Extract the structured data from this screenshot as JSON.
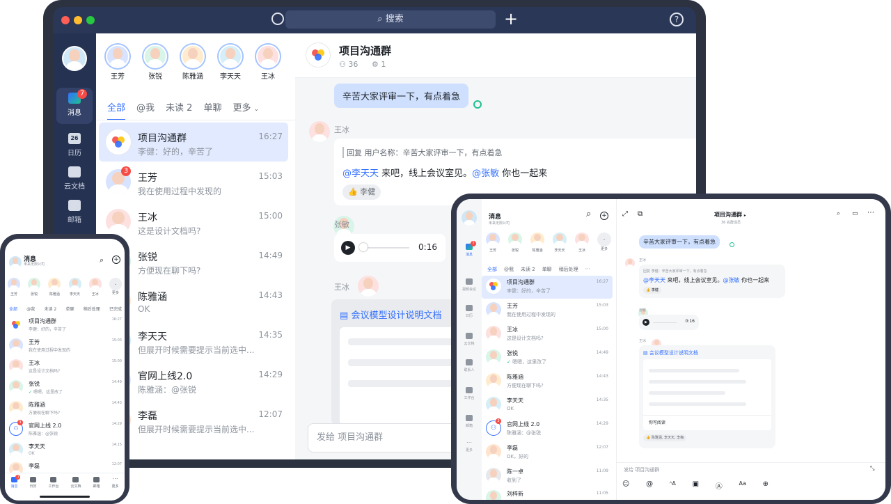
{
  "colors": {
    "accent": "#3370ff",
    "bubble_self": "#cfe0ff",
    "badge": "#f54a45",
    "teal": "#1fbf8f"
  },
  "laptop": {
    "search_placeholder": "搜索",
    "nav": [
      {
        "label": "消息",
        "badge": "7"
      },
      {
        "label": "日历",
        "icon_text": "26"
      },
      {
        "label": "云文档"
      },
      {
        "label": "邮箱"
      }
    ],
    "stories": [
      {
        "name": "王芳"
      },
      {
        "name": "张锐"
      },
      {
        "name": "陈雅涵"
      },
      {
        "name": "李天天"
      },
      {
        "name": "王冰"
      }
    ],
    "tabs": [
      {
        "label": "全部"
      },
      {
        "label": "@我"
      },
      {
        "label": "未读 2"
      },
      {
        "label": "单聊"
      },
      {
        "label": "更多"
      }
    ],
    "conversations": [
      {
        "title": "项目沟通群",
        "snippet": "李健：好的，辛苦了",
        "time": "16:27"
      },
      {
        "title": "王芳",
        "snippet": "我在使用过程中发现的",
        "time": "15:03",
        "badge": "3"
      },
      {
        "title": "王冰",
        "snippet": "这是设计文档吗?",
        "time": "15:00"
      },
      {
        "title": "张锐",
        "snippet": "方便现在聊下吗?",
        "time": "14:49"
      },
      {
        "title": "陈雅涵",
        "snippet": "OK",
        "time": "14:43"
      },
      {
        "title": "李天天",
        "snippet": "但展开时候需要提示当前选中...",
        "time": "14:35"
      },
      {
        "title": "官网上线2.0",
        "snippet": "陈雅涵：@张锐",
        "time": "14:29"
      },
      {
        "title": "李磊",
        "snippet": "但展开时候需要提示当前选中...",
        "time": "12:07"
      }
    ],
    "chat": {
      "title": "项目沟通群",
      "members": "36",
      "bots": "1",
      "msg_self": "辛苦大家评审一下，有点着急",
      "sender_1": "王冰",
      "reply_quote": "回复 用户名称：辛苦大家评审一下，有点着急",
      "mention_1": "@李天天",
      "reply_text": " 来吧，线上会议室见。",
      "mention_2": "@张敏",
      "reply_tail": " 你也一起来",
      "reaction": "李健",
      "sender_2": "张敏",
      "voice_duration": "0:16",
      "sender_3": "王冰",
      "doc_title": "会议模型设计说明文档",
      "input_placeholder": "发给 项目沟通群"
    }
  },
  "phone": {
    "title": "消息",
    "org": "未来无限公司",
    "stories": [
      "王芳",
      "张锐",
      "陈雅涵",
      "李天天",
      "王冰",
      "更多"
    ],
    "tabs": [
      "全部",
      "@我",
      "未读 2",
      "单聊",
      "稍后处理",
      "已完成"
    ],
    "conversations": [
      {
        "title": "项目沟通群",
        "snippet": "李健：好的，辛苦了",
        "time": "16:27"
      },
      {
        "title": "王芳",
        "snippet": "我在使用过程中发现的",
        "time": "15:03"
      },
      {
        "title": "王冰",
        "snippet": "这是设计文档吗?",
        "time": "15:00"
      },
      {
        "title": "张锐",
        "snippet": "嗯嗯，这里改了",
        "time": "14:49"
      },
      {
        "title": "陈雅涵",
        "snippet": "方便现在聊下吗?",
        "time": "14:43"
      },
      {
        "title": "官网上线 2.0",
        "snippet": "陈雅涵：@张锐",
        "time": "14:29",
        "badge": "3"
      },
      {
        "title": "李天天",
        "snippet": "OK",
        "time": "14:15"
      },
      {
        "title": "李磊",
        "snippet": "",
        "time": "12:07"
      }
    ],
    "nav": [
      {
        "label": "消息",
        "badge": "7"
      },
      {
        "label": "日历"
      },
      {
        "label": "工作台"
      },
      {
        "label": "云文档"
      },
      {
        "label": "邮箱"
      },
      {
        "label": "更多"
      }
    ]
  },
  "tablet": {
    "title": "消息",
    "org": "未来无限公司",
    "stories": [
      "王芳",
      "张锐",
      "陈雅涵",
      "李天天",
      "王冰",
      "更多"
    ],
    "tabs": [
      "全部",
      "@我",
      "未读 2",
      "单聊",
      "稍后处理"
    ],
    "nav": [
      {
        "label": "消息",
        "badge": "7"
      },
      {
        "label": "视频会议"
      },
      {
        "label": "日历"
      },
      {
        "label": "云文档"
      },
      {
        "label": "联系人"
      },
      {
        "label": "工作台"
      },
      {
        "label": "邮箱"
      },
      {
        "label": "更多"
      }
    ],
    "conversations": [
      {
        "title": "项目沟通群",
        "snippet": "李健：好的，辛苦了",
        "time": "16:27"
      },
      {
        "title": "王芳",
        "snippet": "我在使用过程中发现的",
        "time": "15:03"
      },
      {
        "title": "王冰",
        "snippet": "这是设计文档吗?",
        "time": "15:00"
      },
      {
        "title": "张锐",
        "snippet": "嗯嗯，这里改了",
        "time": "14:49"
      },
      {
        "title": "陈雅涵",
        "snippet": "方便现在聊下吗?",
        "time": "14:43"
      },
      {
        "title": "李天天",
        "snippet": "OK",
        "time": "14:35"
      },
      {
        "title": "官网上线 2.0",
        "snippet": "陈雅涵：@张锐",
        "time": "14:29",
        "badge": "3"
      },
      {
        "title": "李磊",
        "snippet": "OK，好的",
        "time": "12:07"
      },
      {
        "title": "陈一卓",
        "snippet": "收到了",
        "time": "11:09"
      },
      {
        "title": "刘梓新",
        "snippet": "",
        "time": "11:05"
      }
    ],
    "chat": {
      "title": "项目沟通群",
      "subtitle": "36 名群成员",
      "msg_self": "辛苦大家评审一下，有点着急",
      "sender_1": "王冰",
      "reply_quote": "回复 李健：辛苦大家评审一下，有点着急",
      "mention_1": "@李天天",
      "reply_text": " 来吧，线上会议室见。",
      "mention_2": "@张敏",
      "reply_tail": " 你也一起来",
      "reaction": "李健",
      "sender_2": "张敏",
      "voice_duration": "0:16",
      "sender_3": "王冰",
      "doc_title": "会议模型设计说明文档",
      "doc_note": "你可阅读",
      "doc_readers": "陈雅涵, 李天天, 李梅",
      "input_placeholder": "发给 项目沟通群"
    }
  }
}
